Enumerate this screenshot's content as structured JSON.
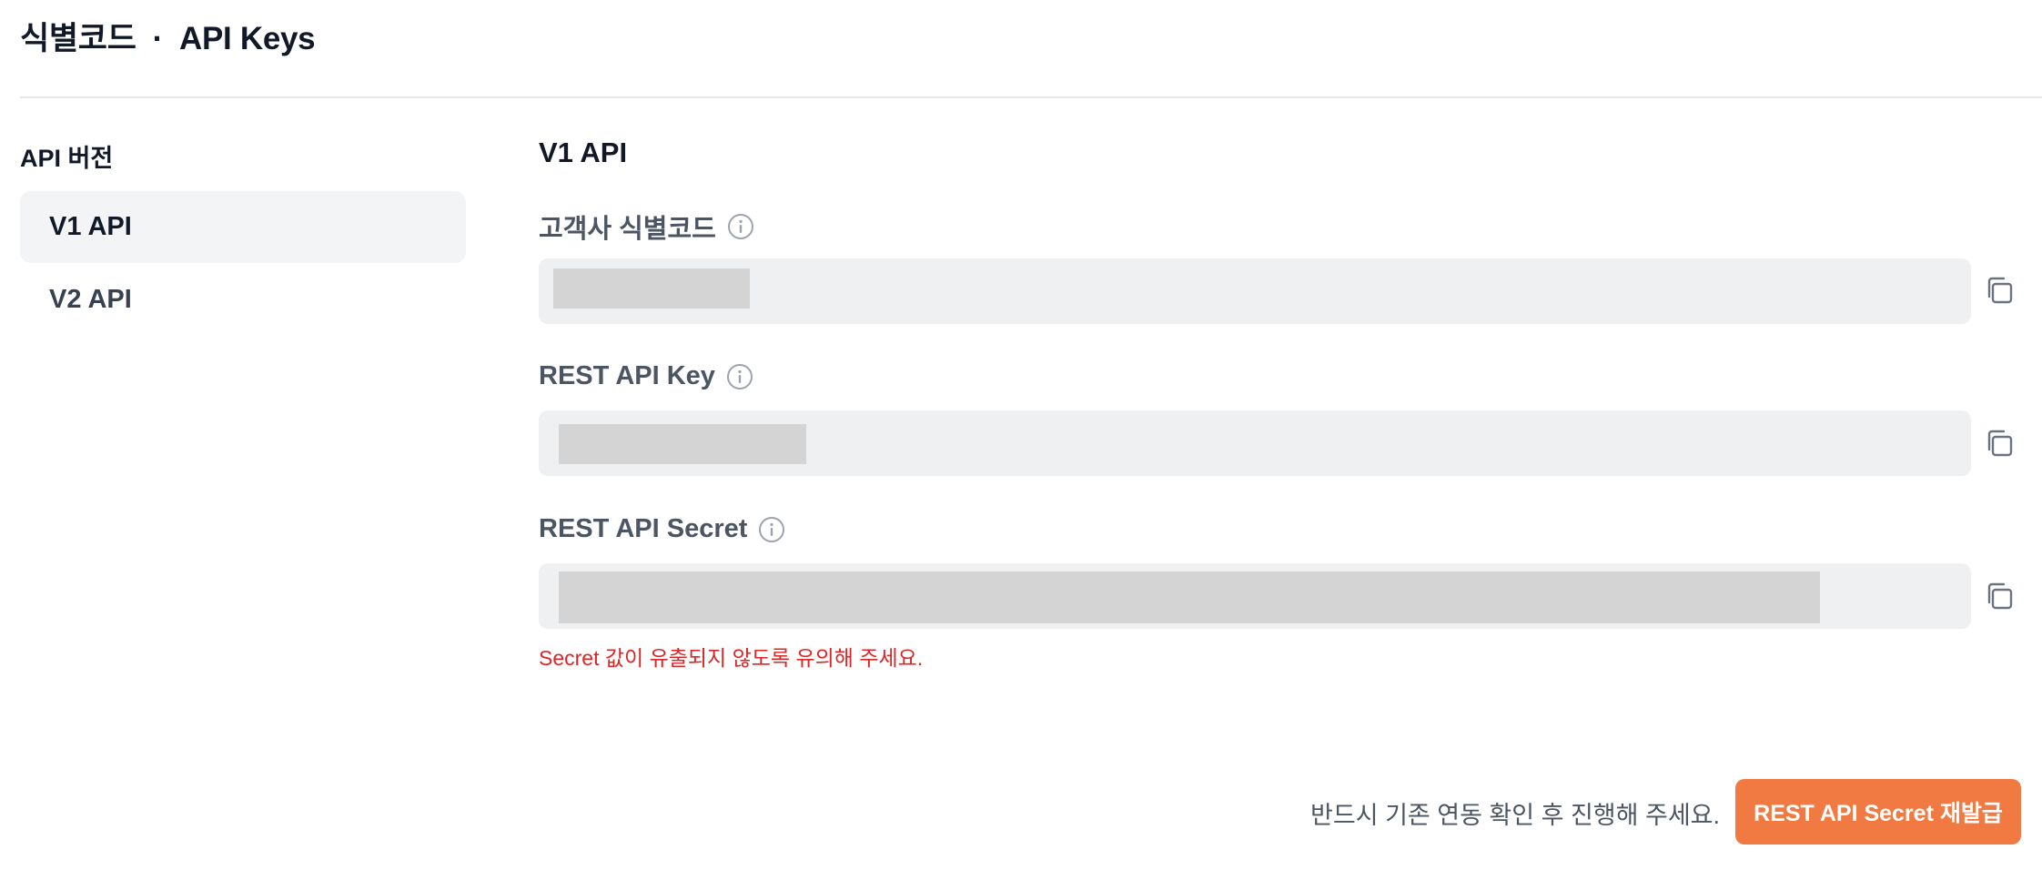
{
  "header": {
    "title_primary": "식별코드",
    "separator": "·",
    "title_secondary": "API Keys"
  },
  "sidebar": {
    "heading": "API 버전",
    "items": [
      {
        "label": "V1 API",
        "active": true
      },
      {
        "label": "V2 API",
        "active": false
      }
    ]
  },
  "main": {
    "section_title": "V1 API",
    "fields": [
      {
        "label": "고객사 식별코드",
        "value_masked": true
      },
      {
        "label": "REST API Key",
        "value_masked": true
      },
      {
        "label": "REST API Secret",
        "value_masked": true
      }
    ],
    "secret_warning": "Secret 값이 유출되지 않도록 유의해 주세요."
  },
  "footer": {
    "note": "반드시 기존 연동 확인 후 진행해 주세요.",
    "reissue_button_label": "REST API Secret 재발급"
  },
  "icons": {
    "info": "info-icon",
    "copy": "copy-icon"
  },
  "colors": {
    "accent": "#f07a42",
    "warning": "#dc2626",
    "field_bg": "#eff0f2",
    "mask": "#d4d4d4",
    "active_nav_bg": "#f3f4f6"
  }
}
